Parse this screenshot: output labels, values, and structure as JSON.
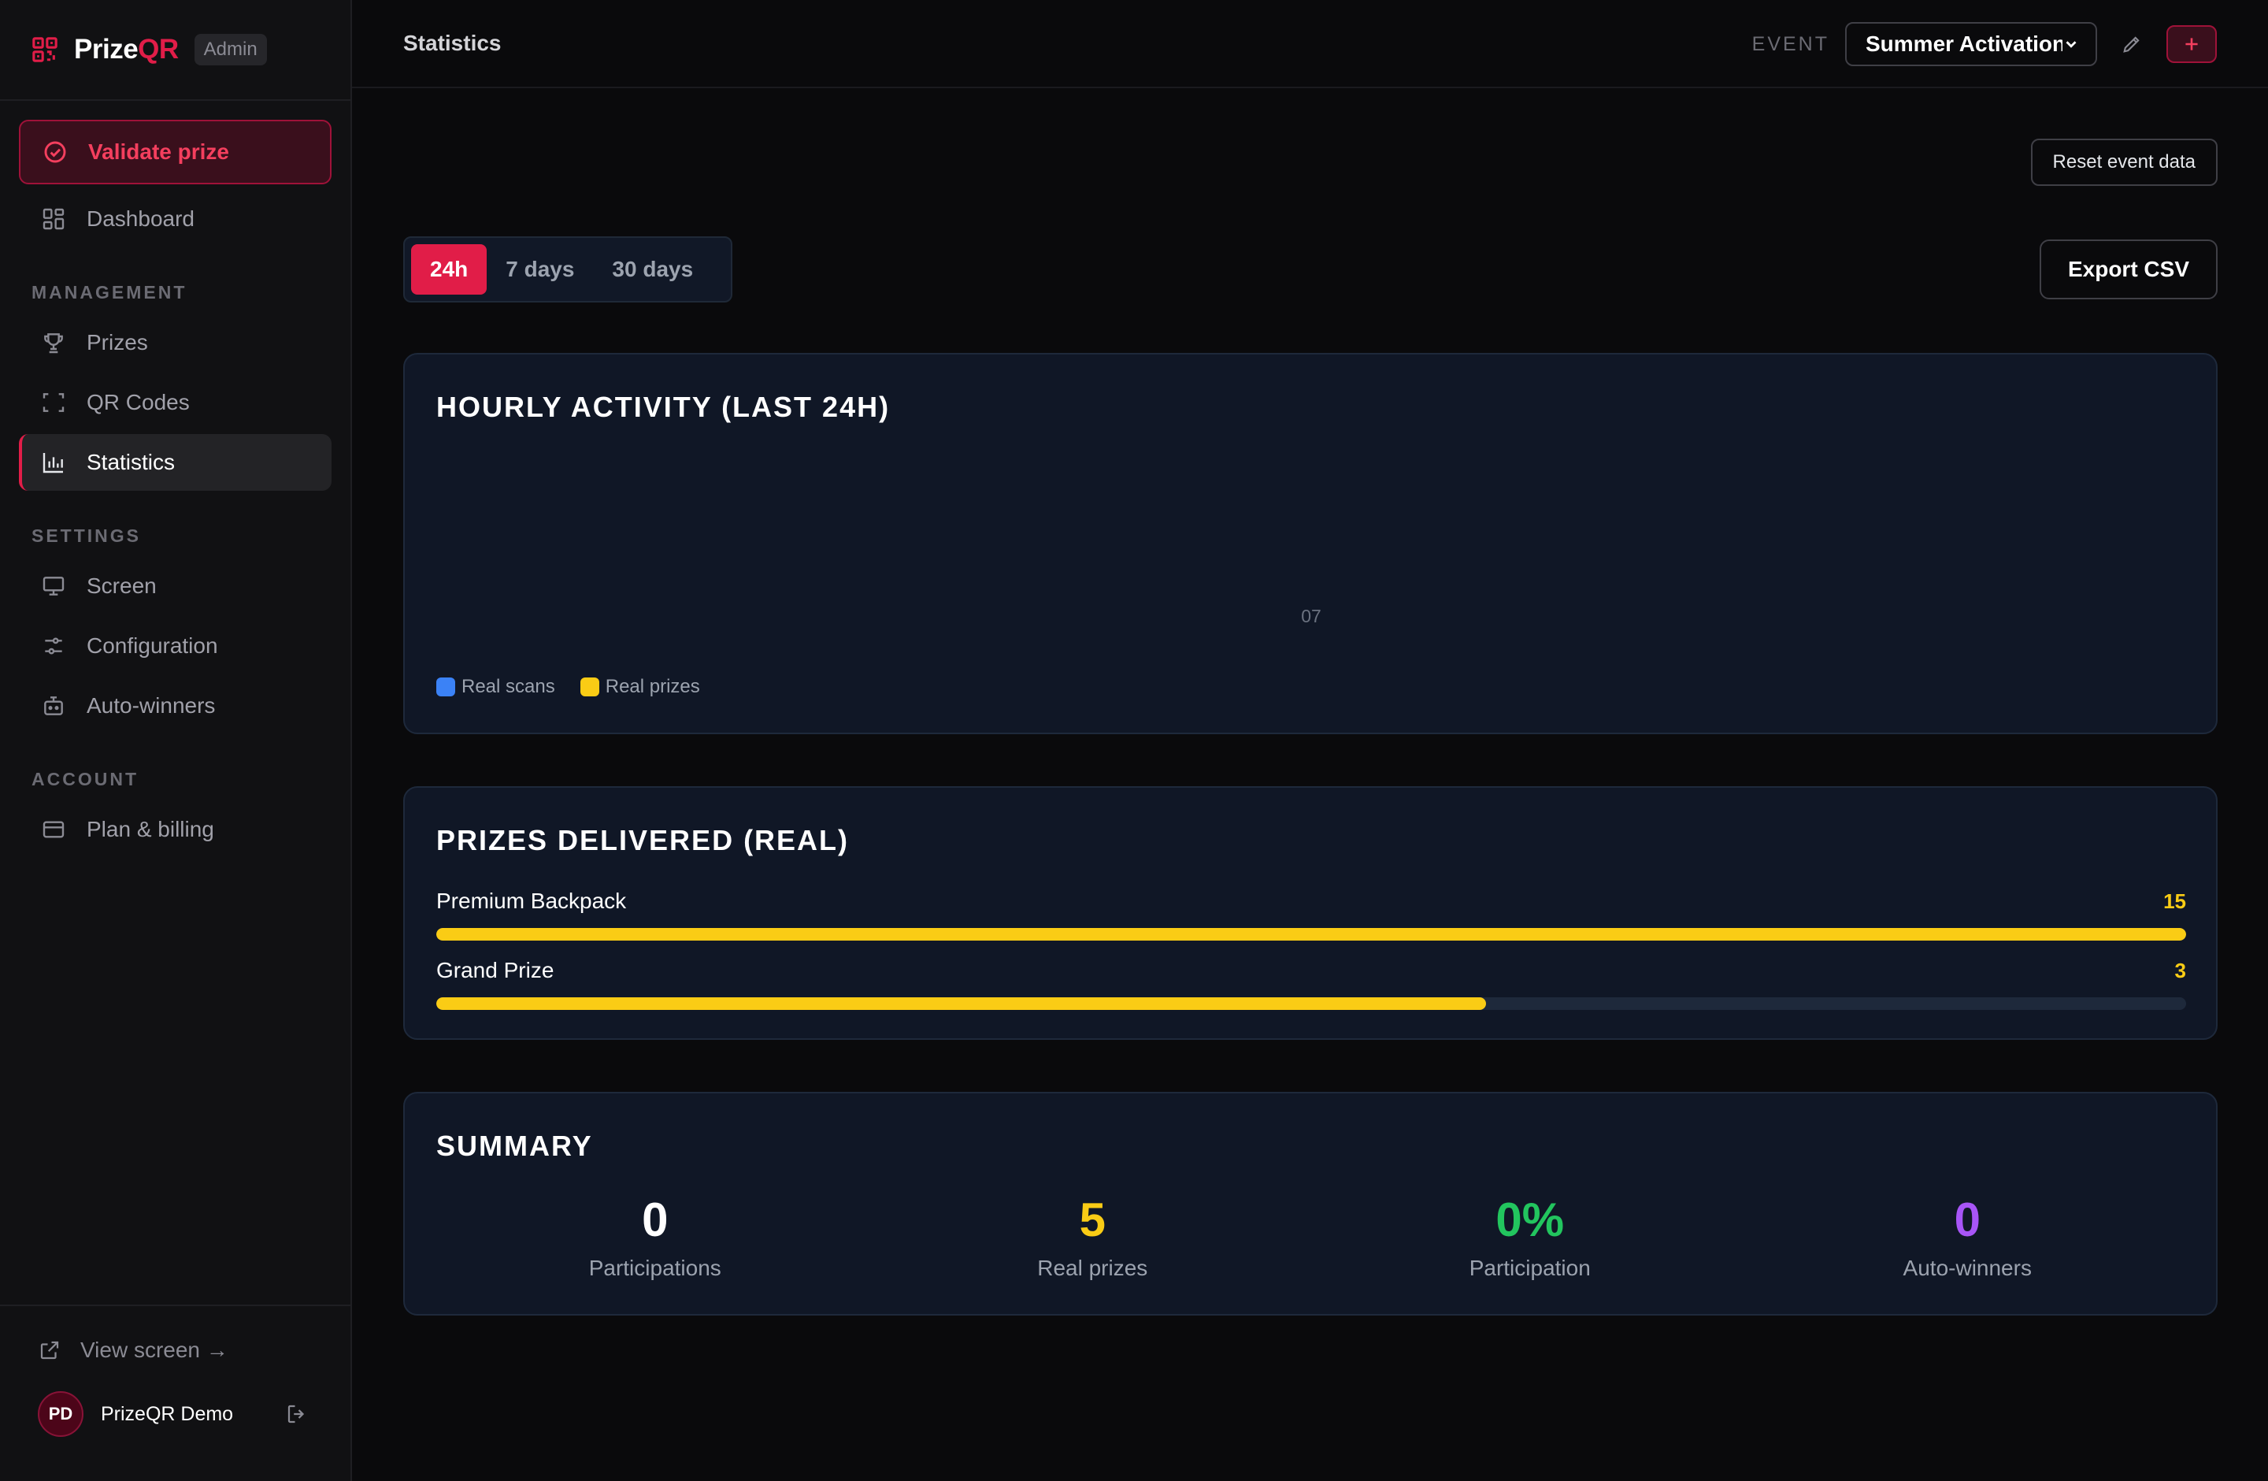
{
  "app": {
    "brand_prefix": "Prize",
    "brand_accent": "QR",
    "role_badge": "Admin",
    "accent_color": "#e11d48"
  },
  "sidebar": {
    "validate_label": "Validate prize",
    "dashboard_label": "Dashboard",
    "sections": {
      "management": "MANAGEMENT",
      "settings": "SETTINGS",
      "account": "ACCOUNT"
    },
    "items": {
      "prizes": "Prizes",
      "qr_codes": "QR Codes",
      "statistics": "Statistics",
      "screen": "Screen",
      "configuration": "Configuration",
      "auto_winners": "Auto-winners",
      "plan_billing": "Plan & billing"
    },
    "active_item": "Statistics",
    "footer": {
      "view_screen": "View screen →",
      "user_initials": "PD",
      "user_name": "PrizeQR Demo"
    }
  },
  "topbar": {
    "title": "Statistics",
    "event_label": "EVENT",
    "event_selected": "Summer Activation"
  },
  "actions": {
    "reset": "Reset event data",
    "export": "Export CSV"
  },
  "range_tabs": {
    "items": [
      "24h",
      "7 days",
      "30 days"
    ],
    "active": "24h"
  },
  "hourly": {
    "title": "HOURLY ACTIVITY (LAST 24H)",
    "legend": {
      "scans": "Real scans",
      "prizes": "Real prizes"
    },
    "colors": {
      "scans": "#3b82f6",
      "prizes": "#facc15"
    }
  },
  "chart_data": {
    "type": "bar",
    "title": "HOURLY ACTIVITY (LAST 24H)",
    "categories": [
      "07"
    ],
    "series": [
      {
        "name": "Real scans",
        "values": [
          0
        ]
      },
      {
        "name": "Real prizes",
        "values": [
          0
        ]
      }
    ],
    "legend": "bottom-left"
  },
  "prizes_delivered": {
    "title": "PRIZES DELIVERED (REAL)",
    "bar_color": "#facc15",
    "items": [
      {
        "name": "Premium Backpack",
        "count": "15",
        "fraction": 1.0
      },
      {
        "name": "Grand Prize",
        "count": "3",
        "fraction": 0.6
      }
    ]
  },
  "summary": {
    "title": "SUMMARY",
    "stats": [
      {
        "value": "0",
        "label": "Participations",
        "color": "#ffffff"
      },
      {
        "value": "5",
        "label": "Real prizes",
        "color": "#facc15"
      },
      {
        "value": "0%",
        "label": "Participation",
        "color": "#22c55e"
      },
      {
        "value": "0",
        "label": "Auto-winners",
        "color": "#a855f7"
      }
    ]
  }
}
